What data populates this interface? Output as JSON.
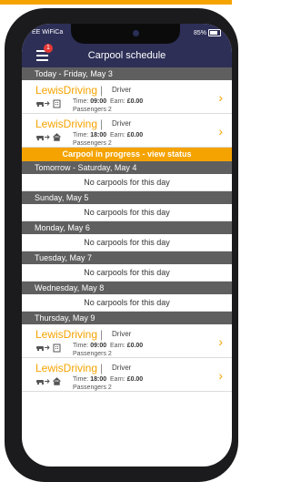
{
  "status_bar": {
    "carrier": "EE WiFiCa",
    "battery": "85%"
  },
  "nav": {
    "title": "Carpool schedule",
    "badge": "1"
  },
  "days": [
    {
      "header": "Today - Friday, May 3",
      "cards": [
        {
          "brand": "LewisDriving",
          "role": "Driver",
          "time": "09:00",
          "earn": "£0.00",
          "passengers": "2",
          "dest_icon": "building-icon"
        },
        {
          "brand": "LewisDriving",
          "role": "Driver",
          "time": "18:00",
          "earn": "£0.00",
          "passengers": "2",
          "dest_icon": "home-icon"
        }
      ]
    },
    {
      "header": "Tomorrow - Saturday, May 4",
      "empty": "No carpools for this day"
    },
    {
      "header": "Sunday, May 5",
      "empty": "No carpools for this day"
    },
    {
      "header": "Monday, May 6",
      "empty": "No carpools for this day"
    },
    {
      "header": "Tuesday, May 7",
      "empty": "No carpools for this day"
    },
    {
      "header": "Wednesday, May 8",
      "empty": "No carpools for this day"
    },
    {
      "header": "Thursday, May 9",
      "cards": [
        {
          "brand": "LewisDriving",
          "role": "Driver",
          "time": "09:00",
          "earn": "£0.00",
          "passengers": "2",
          "dest_icon": "building-icon"
        },
        {
          "brand": "LewisDriving",
          "role": "Driver",
          "time": "18:00",
          "earn": "£0.00",
          "passengers": "2",
          "dest_icon": "home-icon"
        }
      ]
    }
  ],
  "in_progress": "Carpool in progress - view status",
  "labels": {
    "time": "Time:",
    "earn": "Earn:",
    "passengers": "Passengers"
  },
  "colors": {
    "accent": "#f5a300",
    "nav": "#2d2f57",
    "day_header": "#5f5f5f"
  }
}
